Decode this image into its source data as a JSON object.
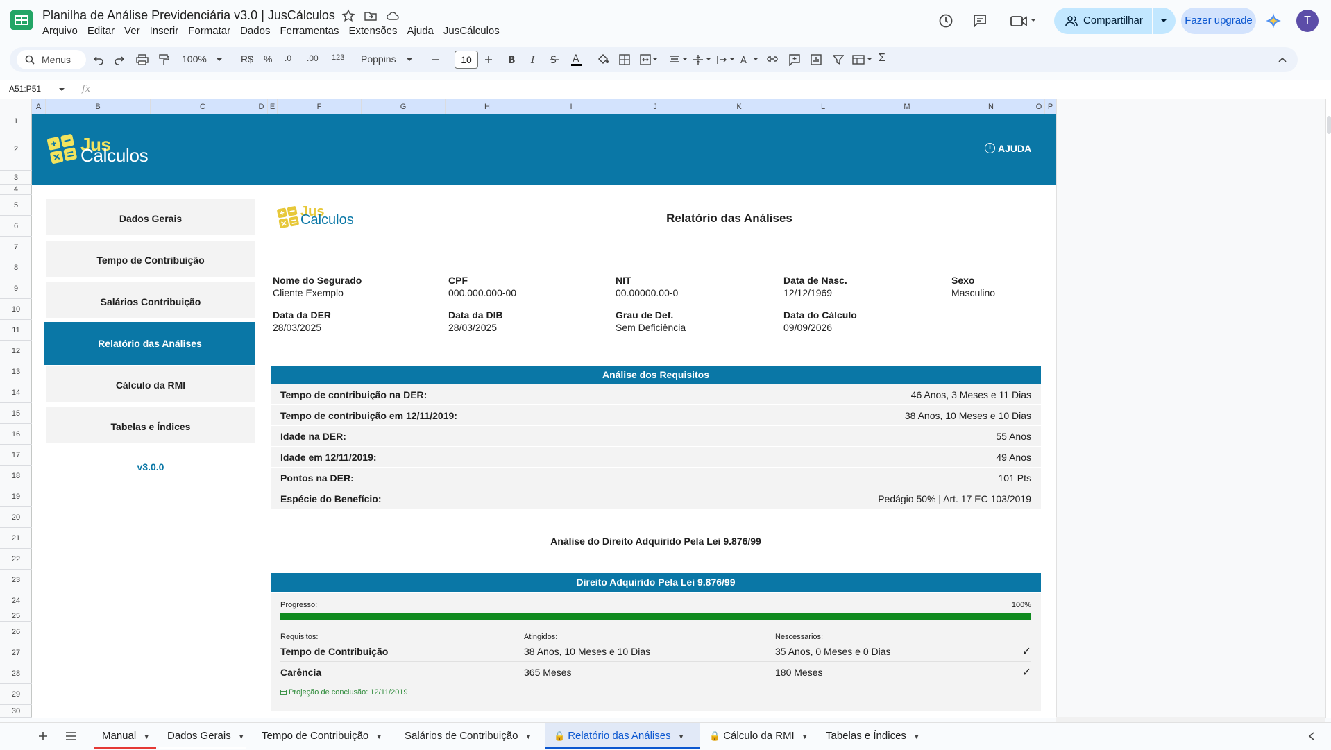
{
  "app": {
    "doc_title": "Planilha de Análise Previdenciária v3.0 | JusCálculos",
    "menu": [
      "Arquivo",
      "Editar",
      "Ver",
      "Inserir",
      "Formatar",
      "Dados",
      "Ferramentas",
      "Extensões",
      "Ajuda",
      "JusCálculos"
    ],
    "share_label": "Compartilhar",
    "upgrade_label": "Fazer upgrade",
    "avatar_initial": "T"
  },
  "toolbar": {
    "menus_label": "Menus",
    "zoom": "100%",
    "currency": "R$",
    "percent": "%",
    "dec_decrease": ".0",
    "dec_increase": ".00",
    "number_format": "123",
    "font": "Poppins",
    "font_size": "10",
    "sum": "Σ"
  },
  "formula_bar": {
    "name_box": "A51:P51",
    "fx": "fx"
  },
  "columns": [
    "A",
    "B",
    "C",
    "D",
    "E",
    "F",
    "G",
    "H",
    "I",
    "J",
    "K",
    "L",
    "M",
    "N",
    "O",
    "P"
  ],
  "rows": [
    "1",
    "2",
    "3",
    "4",
    "5",
    "6",
    "7",
    "8",
    "9",
    "10",
    "11",
    "12",
    "13",
    "14",
    "15",
    "16",
    "17",
    "18",
    "19",
    "20",
    "21",
    "22",
    "23",
    "24",
    "25",
    "26",
    "27",
    "28",
    "29",
    "30"
  ],
  "banner": {
    "logo_jus": "Jus",
    "logo_calculos": "Calculos",
    "help_label": "AJUDA"
  },
  "nav": {
    "items": [
      {
        "label": "Dados Gerais"
      },
      {
        "label": "Tempo de Contribuição"
      },
      {
        "label": "Salários Contribuição"
      },
      {
        "label": "Relatório das Análises"
      },
      {
        "label": "Cálculo da RMI"
      },
      {
        "label": "Tabelas e Índices"
      }
    ],
    "active_index": 3,
    "version": "v3.0.0"
  },
  "report": {
    "logo_jus": "Jus",
    "logo_calculos": "Calculos",
    "title": "Relatório das Análises",
    "fields": [
      {
        "label": "Nome do Segurado",
        "value": "Cliente Exemplo"
      },
      {
        "label": "CPF",
        "value": "000.000.000-00"
      },
      {
        "label": "NIT",
        "value": "00.00000.00-0"
      },
      {
        "label": "Data de Nasc.",
        "value": "12/12/1969"
      },
      {
        "label": "Sexo",
        "value": "Masculino"
      },
      {
        "label": "Data da DER",
        "value": "28/03/2025"
      },
      {
        "label": "Data da DIB",
        "value": "28/03/2025"
      },
      {
        "label": "Grau de Def.",
        "value": "Sem Deficiência"
      },
      {
        "label": "Data do Cálculo",
        "value": "09/09/2026"
      }
    ],
    "requirements_header": "Análise dos Requisitos",
    "requirements": [
      {
        "label": "Tempo de contribuição na DER:",
        "value": "46 Anos, 3 Meses e 11 Dias"
      },
      {
        "label": "Tempo de contribuição em 12/11/2019:",
        "value": "38 Anos, 10 Meses e 10 Dias"
      },
      {
        "label": "Idade na DER:",
        "value": "55 Anos"
      },
      {
        "label": "Idade em 12/11/2019:",
        "value": "49 Anos"
      },
      {
        "label": "Pontos na DER:",
        "value": "101 Pts"
      },
      {
        "label": "Espécie do Benefício:",
        "value": "Pedágio 50% | Art. 17 EC 103/2019"
      }
    ],
    "acquired_title": "Análise do Direito Adquirido Pela Lei 9.876/99",
    "acquired_header": "Direito Adquirido Pela Lei 9.876/99",
    "progress_label": "Progresso:",
    "progress_text": "100%",
    "progress_value": 1.0,
    "col_requisitos": "Requisitos:",
    "col_atingidos": "Atingidos:",
    "col_necessarios": "Nescessarios:",
    "details": [
      {
        "label": "Tempo de Contribuição",
        "achieved": "38 Anos, 10 Meses e 10 Dias",
        "required": "35 Anos, 0 Meses e 0 Dias",
        "check": "✓"
      },
      {
        "label": "Carência",
        "achieved": "365 Meses",
        "required": "180 Meses",
        "check": "✓"
      }
    ],
    "projection_note": "Projeção de conclusão: 12/11/2019"
  },
  "tabs": [
    {
      "label": "Manual",
      "locked": false
    },
    {
      "label": "Dados Gerais",
      "locked": false
    },
    {
      "label": "Tempo de Contribuição",
      "locked": false
    },
    {
      "label": "Salários de Contribuição",
      "locked": false
    },
    {
      "label": "Relatório das Análises",
      "locked": true
    },
    {
      "label": "Cálculo da RMI",
      "locked": true
    },
    {
      "label": "Tabelas e Índices",
      "locked": false
    }
  ],
  "colors": {
    "brand_blue": "#0a77a6",
    "logo_yellow": "#f2e35d",
    "progress_green": "#0f8a1e"
  }
}
